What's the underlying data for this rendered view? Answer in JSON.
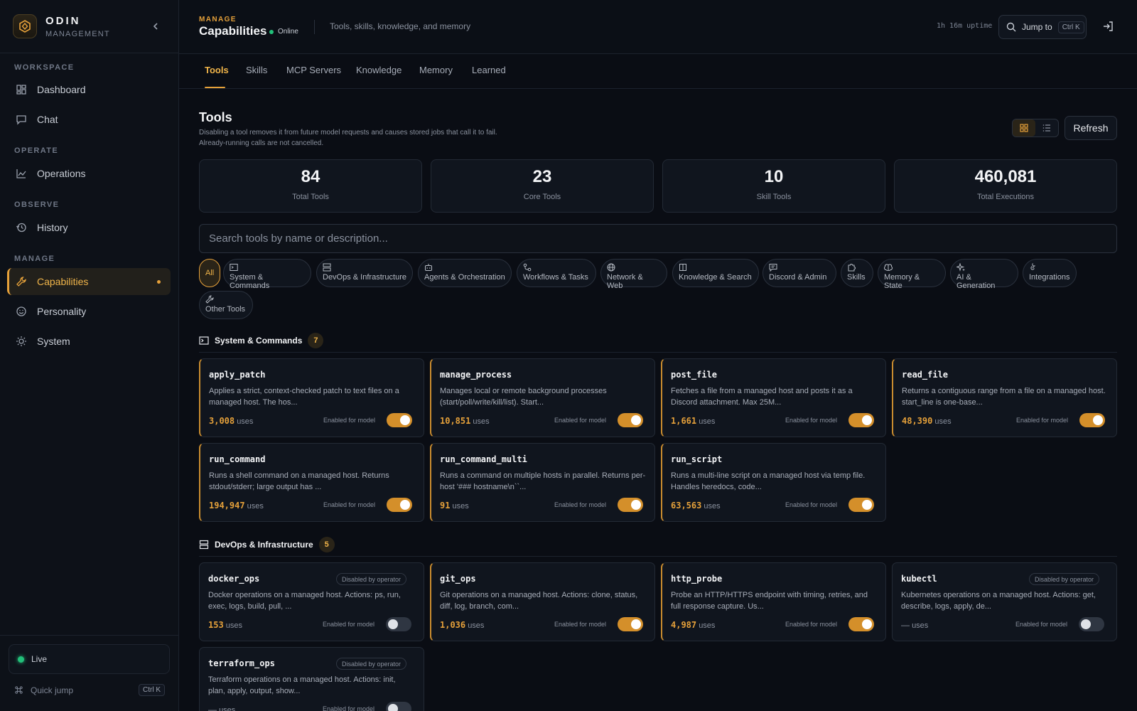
{
  "brand": {
    "name": "ODIN",
    "subtitle": "MANAGEMENT"
  },
  "sidebar": {
    "sections": [
      {
        "label": "WORKSPACE"
      },
      {
        "label": "OPERATE"
      },
      {
        "label": "OBSERVE"
      },
      {
        "label": "MANAGE"
      }
    ],
    "items": [
      {
        "label": "Dashboard",
        "icon": "dashboard-icon"
      },
      {
        "label": "Chat",
        "icon": "chat-icon"
      },
      {
        "label": "Operations",
        "icon": "chart-icon"
      },
      {
        "label": "History",
        "icon": "history-icon"
      },
      {
        "label": "Capabilities",
        "icon": "wrench-icon",
        "active": true
      },
      {
        "label": "Personality",
        "icon": "smile-icon"
      },
      {
        "label": "System",
        "icon": "sun-icon"
      }
    ],
    "live_label": "Live",
    "quick_jump": {
      "label": "Quick jump",
      "shortcut": "Ctrl K"
    }
  },
  "header": {
    "eyebrow": "MANAGE",
    "title": "Capabilities",
    "status": "Online",
    "description": "Tools, skills, knowledge, and memory",
    "uptime": "1h 16m uptime",
    "jump_label": "Jump to",
    "jump_shortcut": "Ctrl K"
  },
  "tabs": [
    "Tools",
    "Skills",
    "MCP Servers",
    "Knowledge",
    "Memory",
    "Learned"
  ],
  "tools": {
    "title": "Tools",
    "description_line1": "Disabling a tool removes it from future model requests and causes stored jobs that call it to fail.",
    "description_line2": "Already-running calls are not cancelled.",
    "refresh_label": "Refresh",
    "stats": [
      {
        "value": "84",
        "label": "Total Tools"
      },
      {
        "value": "23",
        "label": "Core Tools"
      },
      {
        "value": "10",
        "label": "Skill Tools"
      },
      {
        "value": "460,081",
        "label": "Total Executions"
      }
    ],
    "search_placeholder": "Search tools by name or description...",
    "filters": [
      "All",
      "System & Commands",
      "DevOps & Infrastructure",
      "Agents & Orchestration",
      "Workflows & Tasks",
      "Network & Web",
      "Knowledge & Search",
      "Discord & Admin",
      "Skills",
      "Memory & State",
      "AI & Generation",
      "Integrations",
      "Other Tools"
    ],
    "enabled_label": "Enabled for model",
    "uses_label": "uses",
    "disabled_label": "Disabled by operator",
    "groups": [
      {
        "name": "System & Commands",
        "count": "7",
        "tools": [
          {
            "name": "apply_patch",
            "desc": "Applies a strict, context-checked patch to text files on a managed host. The hos...",
            "uses": "3,008",
            "enabled": true
          },
          {
            "name": "manage_process",
            "desc": "Manages local or remote background processes (start/poll/write/kill/list). Start...",
            "uses": "10,851",
            "enabled": true
          },
          {
            "name": "post_file",
            "desc": "Fetches a file from a managed host and posts it as a Discord attachment. Max 25M...",
            "uses": "1,661",
            "enabled": true
          },
          {
            "name": "read_file",
            "desc": "Returns a contiguous range from a file on a managed host. start_line is one-base...",
            "uses": "48,390",
            "enabled": true
          },
          {
            "name": "run_command",
            "desc": "Runs a shell command on a managed host. Returns stdout/stderr; large output has ...",
            "uses": "194,947",
            "enabled": true
          },
          {
            "name": "run_command_multi",
            "desc": "Runs a command on multiple hosts in parallel. Returns per-host '### hostname\\n``...",
            "uses": "91",
            "enabled": true
          },
          {
            "name": "run_script",
            "desc": "Runs a multi-line script on a managed host via temp file. Handles heredocs, code...",
            "uses": "63,563",
            "enabled": true
          }
        ]
      },
      {
        "name": "DevOps & Infrastructure",
        "count": "5",
        "tools": [
          {
            "name": "docker_ops",
            "desc": "Docker operations on a managed host. Actions: ps, run, exec, logs, build, pull, ...",
            "uses": "153",
            "enabled": false
          },
          {
            "name": "git_ops",
            "desc": "Git operations on a managed host. Actions: clone, status, diff, log, branch, com...",
            "uses": "1,036",
            "enabled": true
          },
          {
            "name": "http_probe",
            "desc": "Probe an HTTP/HTTPS endpoint with timing, retries, and full response capture. Us...",
            "uses": "4,987",
            "enabled": true
          },
          {
            "name": "kubectl",
            "desc": "Kubernetes operations on a managed host. Actions: get, describe, logs, apply, de...",
            "uses": "—",
            "enabled": false
          },
          {
            "name": "terraform_ops",
            "desc": "Terraform operations on a managed host. Actions: init, plan, apply, output, show...",
            "uses": "—",
            "enabled": false
          }
        ]
      }
    ]
  },
  "colors": {
    "accent": "#e6a13a",
    "online": "#22c07a",
    "background": "#0a0d14"
  }
}
